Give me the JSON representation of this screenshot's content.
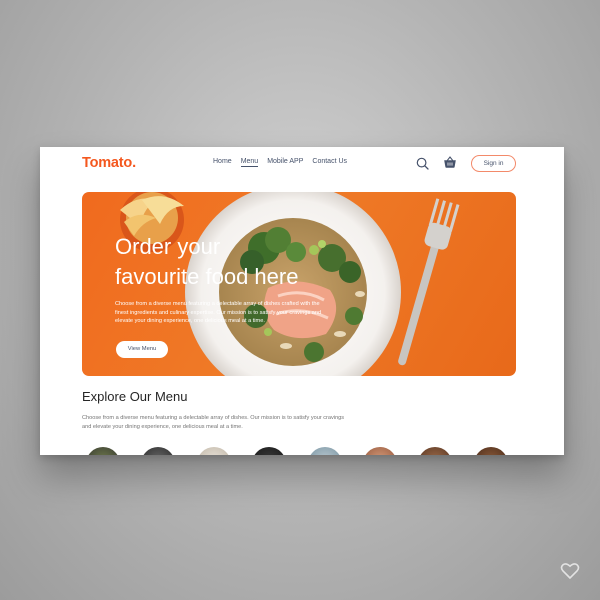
{
  "app": {
    "logo": "Tomato."
  },
  "nav": {
    "links": [
      {
        "label": "Home"
      },
      {
        "label": "Menu"
      },
      {
        "label": "Mobile APP"
      },
      {
        "label": "Contact Us"
      }
    ],
    "active": "Menu",
    "signin_label": "Sign in"
  },
  "hero": {
    "title_line1": "Order your",
    "title_line2": "favourite food here",
    "description": "Choose from a diverse menu featuring a delectable array of dishes crafted with the finest ingredients and culinary expertise. Our mission is to satisfy your cravings and elevate your dining experience, one delicious meal at a time.",
    "button_label": "View Menu"
  },
  "explore": {
    "title": "Explore Our Menu",
    "description": "Choose from a diverse menu featuring a delectable array of dishes. Our mission is to satisfy your cravings and elevate your dining experience, one delicious meal at a time."
  },
  "colors": {
    "brand": "#f4581f",
    "hero_bg": "#ef7a27",
    "nav_text": "#46526b"
  },
  "icons": [
    "search-icon",
    "basket-icon",
    "heart-icon"
  ]
}
